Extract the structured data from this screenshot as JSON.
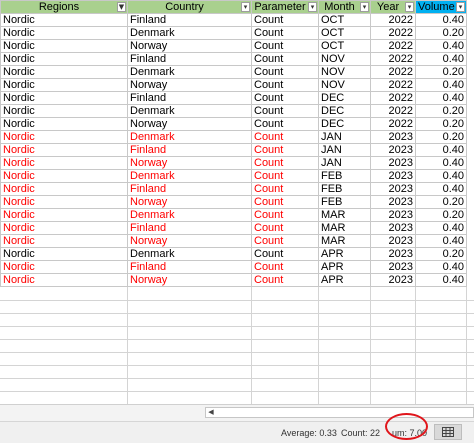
{
  "headers": [
    "Regions",
    "Country",
    "Parameter",
    "Month",
    "Year",
    "Volume"
  ],
  "rows": [
    {
      "region": "Nordic",
      "country": "Finland",
      "parameter": "Count",
      "month": "OCT",
      "year": "2022",
      "volume": "0.40",
      "red": false
    },
    {
      "region": "Nordic",
      "country": "Denmark",
      "parameter": "Count",
      "month": "OCT",
      "year": "2022",
      "volume": "0.20",
      "red": false
    },
    {
      "region": "Nordic",
      "country": "Norway",
      "parameter": "Count",
      "month": "OCT",
      "year": "2022",
      "volume": "0.40",
      "red": false
    },
    {
      "region": "Nordic",
      "country": "Finland",
      "parameter": "Count",
      "month": "NOV",
      "year": "2022",
      "volume": "0.40",
      "red": false
    },
    {
      "region": "Nordic",
      "country": "Denmark",
      "parameter": "Count",
      "month": "NOV",
      "year": "2022",
      "volume": "0.20",
      "red": false
    },
    {
      "region": "Nordic",
      "country": "Norway",
      "parameter": "Count",
      "month": "NOV",
      "year": "2022",
      "volume": "0.40",
      "red": false
    },
    {
      "region": "Nordic",
      "country": "Finland",
      "parameter": "Count",
      "month": "DEC",
      "year": "2022",
      "volume": "0.40",
      "red": false
    },
    {
      "region": "Nordic",
      "country": "Denmark",
      "parameter": "Count",
      "month": "DEC",
      "year": "2022",
      "volume": "0.20",
      "red": false
    },
    {
      "region": "Nordic",
      "country": "Norway",
      "parameter": "Count",
      "month": "DEC",
      "year": "2022",
      "volume": "0.20",
      "red": false
    },
    {
      "region": "Nordic",
      "country": "Denmark",
      "parameter": "Count",
      "month": "JAN",
      "year": "2023",
      "volume": "0.20",
      "red": true
    },
    {
      "region": "Nordic",
      "country": "Finland",
      "parameter": "Count",
      "month": "JAN",
      "year": "2023",
      "volume": "0.40",
      "red": true
    },
    {
      "region": "Nordic",
      "country": "Norway",
      "parameter": "Count",
      "month": "JAN",
      "year": "2023",
      "volume": "0.40",
      "red": true
    },
    {
      "region": "Nordic",
      "country": "Denmark",
      "parameter": "Count",
      "month": "FEB",
      "year": "2023",
      "volume": "0.40",
      "red": true
    },
    {
      "region": "Nordic",
      "country": "Finland",
      "parameter": "Count",
      "month": "FEB",
      "year": "2023",
      "volume": "0.40",
      "red": true
    },
    {
      "region": "Nordic",
      "country": "Norway",
      "parameter": "Count",
      "month": "FEB",
      "year": "2023",
      "volume": "0.20",
      "red": true
    },
    {
      "region": "Nordic",
      "country": "Denmark",
      "parameter": "Count",
      "month": "MAR",
      "year": "2023",
      "volume": "0.20",
      "red": true
    },
    {
      "region": "Nordic",
      "country": "Finland",
      "parameter": "Count",
      "month": "MAR",
      "year": "2023",
      "volume": "0.40",
      "red": true
    },
    {
      "region": "Nordic",
      "country": "Norway",
      "parameter": "Count",
      "month": "MAR",
      "year": "2023",
      "volume": "0.40",
      "red": true
    },
    {
      "region": "Nordic",
      "country": "Denmark",
      "parameter": "Count",
      "month": "APR",
      "year": "2023",
      "volume": "0.20",
      "red": false
    },
    {
      "region": "Nordic",
      "country": "Finland",
      "parameter": "Count",
      "month": "APR",
      "year": "2023",
      "volume": "0.40",
      "red": true
    },
    {
      "region": "Nordic",
      "country": "Norway",
      "parameter": "Count",
      "month": "APR",
      "year": "2023",
      "volume": "0.40",
      "red": true
    }
  ],
  "status": {
    "average": "Average:  0.33",
    "count": "Count: 22",
    "sum": "um:  7.00"
  },
  "icons": {
    "filter_active": "filter-funnel-icon",
    "filter_dropdown": "dropdown-arrow-icon",
    "scroll_left": "scroll-left-arrow-icon",
    "normal_view": "normal-view-grid-icon"
  },
  "colors": {
    "header_green": "#a9d08e",
    "header_selected": "#00b0f0",
    "highlight_text": "#ff0000",
    "annotation_circle": "#e0151b"
  }
}
